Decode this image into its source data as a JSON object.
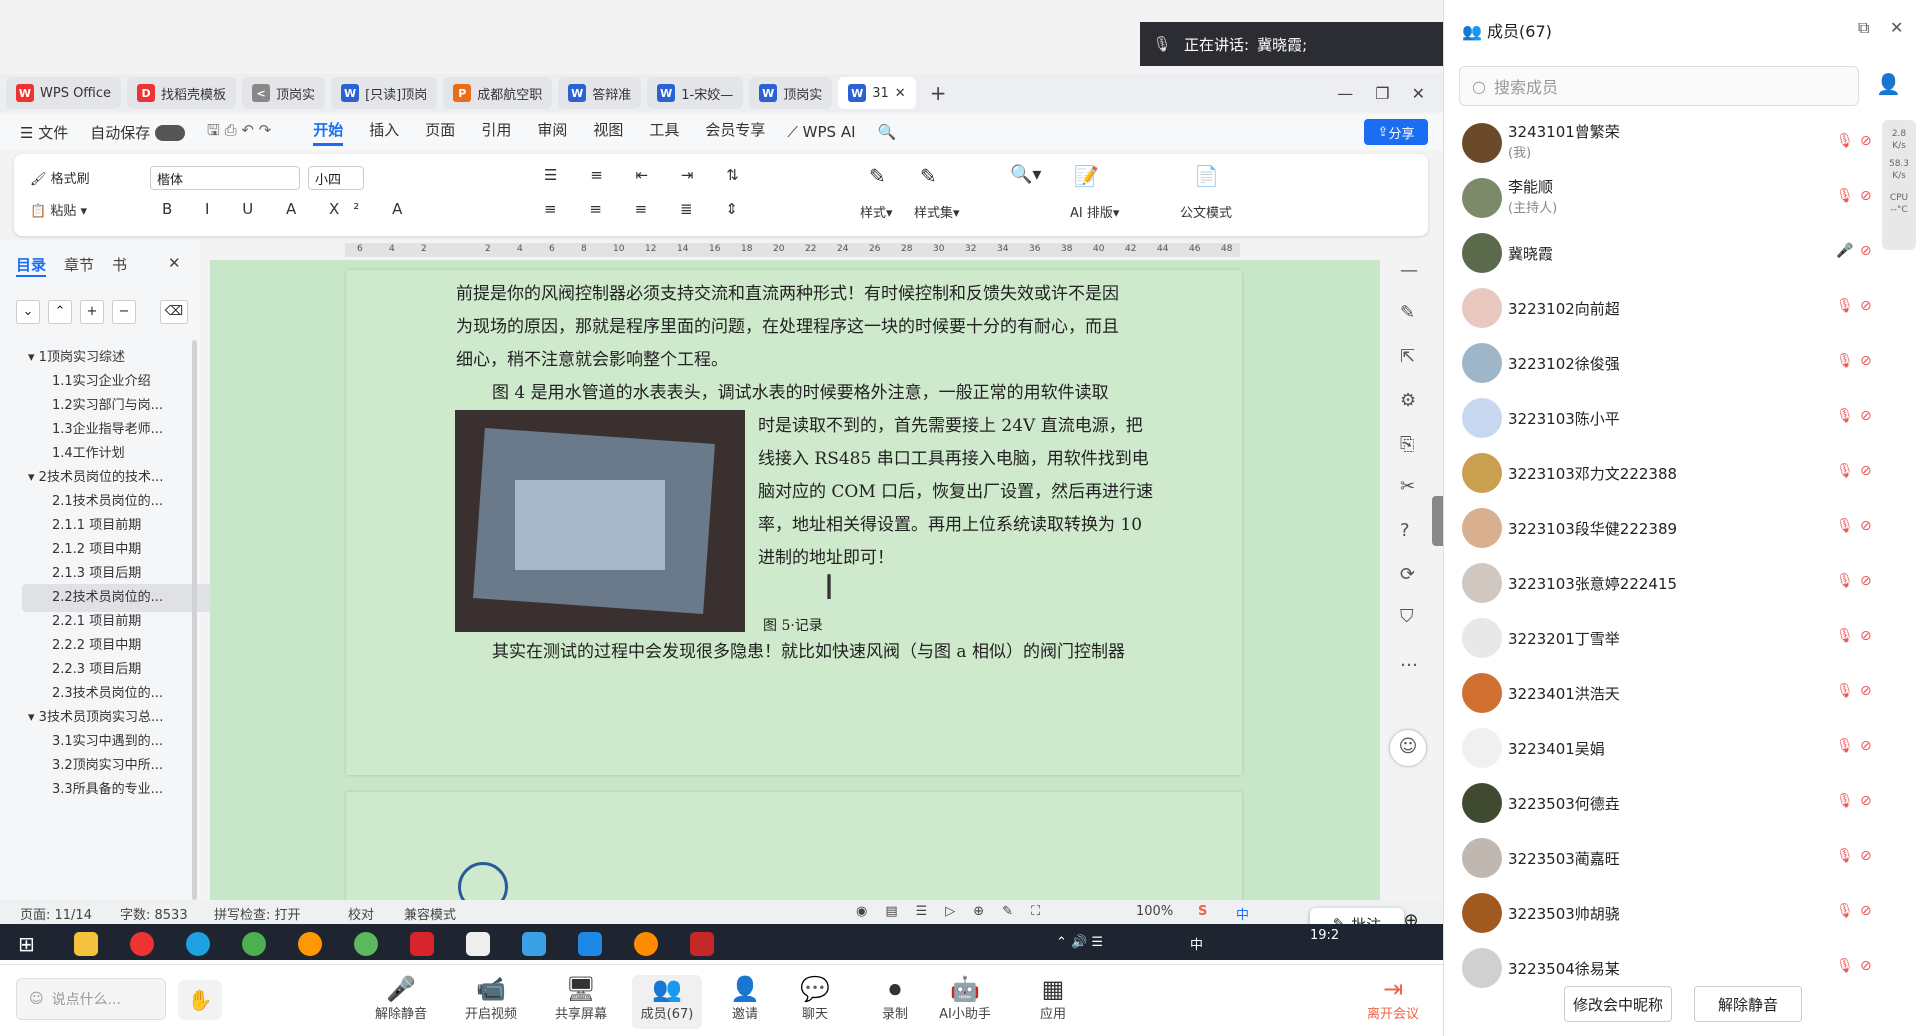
{
  "speaking": {
    "label": "正在讲话:",
    "name": "冀晓霞;"
  },
  "tabs": [
    {
      "label": "WPS Office",
      "icon": "W",
      "color": "#e33"
    },
    {
      "label": "找稻壳模板",
      "icon": "D",
      "color": "#e33"
    },
    {
      "label": "顶岗实",
      "icon": "<",
      "color": "#888"
    },
    {
      "label": "[只读]顶岗",
      "icon": "W",
      "color": "#2a62d6"
    },
    {
      "label": "成都航空职",
      "icon": "P",
      "color": "#e86e1c"
    },
    {
      "label": "答辩准",
      "icon": "W",
      "color": "#2a62d6"
    },
    {
      "label": "1-宋姣—",
      "icon": "W",
      "color": "#2a62d6"
    },
    {
      "label": "顶岗实",
      "icon": "W",
      "color": "#2a62d6"
    },
    {
      "label": "31",
      "icon": "W",
      "color": "#2a62d6"
    }
  ],
  "menu": {
    "file": "文件",
    "autosave": "自动保存",
    "items": [
      "开始",
      "插入",
      "页面",
      "引用",
      "审阅",
      "视图",
      "工具",
      "会员专享"
    ],
    "wpsai": "WPS AI",
    "share": "分享"
  },
  "ribbon": {
    "format_painter": "格式刷",
    "paste": "粘贴",
    "font": "楷体",
    "size": "小四",
    "style": "样式",
    "style_set": "样式集",
    "ai_layout": "AI 排版",
    "official": "公文模式"
  },
  "nav": {
    "tabs": [
      "目录",
      "章节",
      "书"
    ],
    "items": [
      {
        "label": "1顶岗实习综述",
        "lvl": 1
      },
      {
        "label": "1.1实习企业介绍",
        "lvl": 2
      },
      {
        "label": "1.2实习部门与岗...",
        "lvl": 2
      },
      {
        "label": "1.3企业指导老师...",
        "lvl": 2
      },
      {
        "label": "1.4工作计划",
        "lvl": 2
      },
      {
        "label": "2技术员岗位的技术...",
        "lvl": 1
      },
      {
        "label": "2.1技术员岗位的...",
        "lvl": 2
      },
      {
        "label": "2.1.1 项目前期",
        "lvl": 2
      },
      {
        "label": "2.1.2 项目中期",
        "lvl": 2
      },
      {
        "label": "2.1.3 项目后期",
        "lvl": 2
      },
      {
        "label": "2.2技术员岗位的...",
        "lvl": 2,
        "selected": true
      },
      {
        "label": "2.2.1 项目前期",
        "lvl": 2
      },
      {
        "label": "2.2.2 项目中期",
        "lvl": 2
      },
      {
        "label": "2.2.3 项目后期",
        "lvl": 2
      },
      {
        "label": "2.3技术员岗位的...",
        "lvl": 2
      },
      {
        "label": "3技术员顶岗实习总...",
        "lvl": 1
      },
      {
        "label": "3.1实习中遇到的...",
        "lvl": 2
      },
      {
        "label": "3.2顶岗实习中所...",
        "lvl": 2
      },
      {
        "label": "3.3所具备的专业...",
        "lvl": 2
      }
    ]
  },
  "ruler_ticks": [
    "6",
    "4",
    "2",
    "",
    "2",
    "4",
    "6",
    "8",
    "10",
    "12",
    "14",
    "16",
    "18",
    "20",
    "22",
    "24",
    "26",
    "28",
    "30",
    "32",
    "34",
    "36",
    "38",
    "40",
    "42",
    "44",
    "46",
    "48"
  ],
  "doc": {
    "lines_top": [
      "前提是你的风阀控制器必须支持交流和直流两种形式！有时候控制和反馈失效或许不是因",
      "为现场的原因，那就是程序里面的问题，在处理程序这一块的时候要十分的有耐心，而且",
      "细心，稍不注意就会影响整个工程。"
    ],
    "line_fig4": "图 4 是用水管道的水表表头，调试水表的时候要格外注意，一般正常的用软件读取",
    "lines_right": [
      "时是读取不到的，首先需要接上 24V 直流电源，把",
      "线接入 RS485 串口工具再接入电脑，用软件找到电",
      "脑对应的 COM 口后，恢复出厂设置，然后再进行速",
      "率，地址相关得设置。再用上位系统读取转换为 10",
      "进制的地址即可！"
    ],
    "caption": "图 5·记录",
    "line_bottom": "其实在测试的过程中会发现很多隐患！就比如快速风阀（与图 a 相似）的阀门控制器"
  },
  "status": {
    "page": "页面: 11/14",
    "words": "字数: 8533",
    "spell": "拼写检查: 打开",
    "proof": "校对",
    "compat": "兼容模式",
    "zoom": "100%",
    "annot": "批注",
    "ime": "中",
    "clock": "19:2"
  },
  "toolbar": {
    "chat_placeholder": "说点什么...",
    "items": [
      "解除静音",
      "开启视频",
      "共享屏幕",
      "成员(67)",
      "邀请",
      "聊天",
      "录制",
      "AI小助手",
      "应用"
    ],
    "leave": "离开会议"
  },
  "panel": {
    "title": "成员(67)",
    "search_placeholder": "搜索成员",
    "members": [
      {
        "name": "3243101曾繁荣",
        "sub": "(我)",
        "av": "#6b4a2a"
      },
      {
        "name": "李能顺",
        "sub": "(主持人)",
        "av": "#7c8a6a"
      },
      {
        "name": "冀晓霞",
        "sub": "",
        "av": "#5a6a4a",
        "speaking": true
      },
      {
        "name": "3223102向前超",
        "sub": "",
        "av": "#e9c8c0"
      },
      {
        "name": "3223102徐俊强",
        "sub": "",
        "av": "#9fb5c8"
      },
      {
        "name": "3223103陈小平",
        "sub": "",
        "av": "#c8d8f0"
      },
      {
        "name": "3223103邓力文222388",
        "sub": "",
        "av": "#c9a050"
      },
      {
        "name": "3223103段华健222389",
        "sub": "",
        "av": "#d8b090"
      },
      {
        "name": "3223103张意婷222415",
        "sub": "",
        "av": "#d0c8c0"
      },
      {
        "name": "3223201丁雪举",
        "sub": "",
        "av": "#e8e8e8"
      },
      {
        "name": "3223401洪浩天",
        "sub": "",
        "av": "#d07030"
      },
      {
        "name": "3223401吴娟",
        "sub": "",
        "av": "#f0f0f0"
      },
      {
        "name": "3223503何德垚",
        "sub": "",
        "av": "#404a30"
      },
      {
        "name": "3223503蔺嘉旺",
        "sub": "",
        "av": "#c0b8b0"
      },
      {
        "name": "3223503帅胡骁",
        "sub": "",
        "av": "#a05a20"
      },
      {
        "name": "3223504徐易某",
        "sub": "",
        "av": "#d0d0d0"
      }
    ],
    "rename": "修改会中昵称",
    "unmute": "解除静音"
  },
  "netmon": {
    "up": "2.8",
    "down": "58.3",
    "unit": "K/s",
    "cpu": "CPU",
    "temp": "--°C"
  }
}
